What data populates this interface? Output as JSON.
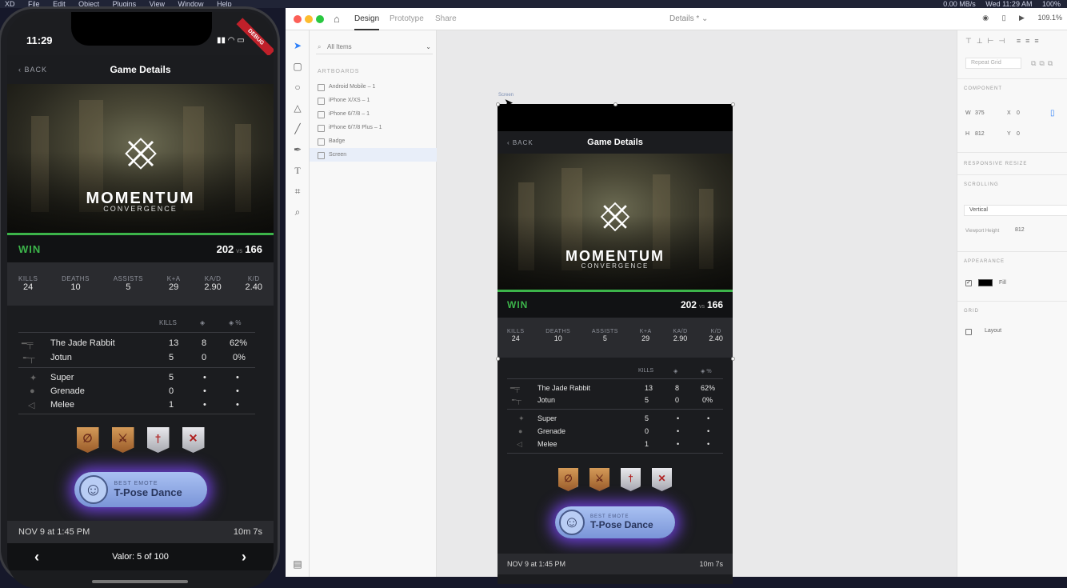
{
  "menubar": {
    "app": "XD",
    "items": [
      "File",
      "Edit",
      "Object",
      "Plugins",
      "View",
      "Window",
      "Help"
    ],
    "right": [
      "0.00 MB/s",
      "Wed 11:29 AM",
      "100%"
    ]
  },
  "phone": {
    "time": "11:29",
    "debug": "DEBUG",
    "valor_prev": "‹",
    "valor_text": "Valor: 5 of 100",
    "valor_next": "›"
  },
  "game": {
    "back": "BACK",
    "title": "Game Details",
    "map_name": "MOMENTUM",
    "map_sub": "CONVERGENCE",
    "result": "WIN",
    "score_a": "202",
    "vs": "vs",
    "score_b": "166",
    "stats": [
      {
        "label": "KILLS",
        "value": "24"
      },
      {
        "label": "DEATHS",
        "value": "10"
      },
      {
        "label": "ASSISTS",
        "value": "5"
      },
      {
        "label": "K+A",
        "value": "29"
      },
      {
        "label": "KA/D",
        "value": "2.90"
      },
      {
        "label": "K/D",
        "value": "2.40"
      }
    ],
    "table_headers": [
      "KILLS",
      "◈",
      "◈ %"
    ],
    "weapons": [
      {
        "name": "The Jade Rabbit",
        "kills": "13",
        "prec": "8",
        "pct": "62%"
      },
      {
        "name": "Jotun",
        "kills": "5",
        "prec": "0",
        "pct": "0%"
      }
    ],
    "abilities": [
      {
        "name": "Super",
        "kills": "5",
        "prec": "•",
        "pct": "•"
      },
      {
        "name": "Grenade",
        "kills": "0",
        "prec": "•",
        "pct": "•"
      },
      {
        "name": "Melee",
        "kills": "1",
        "prec": "•",
        "pct": "•"
      }
    ],
    "medal_badges": [
      "2",
      "",
      "3",
      ""
    ],
    "emote_label": "BEST EMOTE",
    "emote_name": "T-Pose Dance",
    "date": "NOV 9 at 1:45 PM",
    "duration": "10m 7s"
  },
  "xd": {
    "tabs": [
      "Design",
      "Prototype",
      "Share"
    ],
    "doc_title": "Details * ⌄",
    "zoom": "109.1%",
    "search_placeholder": "All Items",
    "artboards_header": "ARTBOARDS",
    "artboards": [
      "Android Mobile – 1",
      "iPhone X/XS – 1",
      "iPhone 6/7/8 – 1",
      "iPhone 6/7/8 Plus – 1",
      "Badge",
      "Screen"
    ],
    "selected_artboard": "Screen",
    "canvas_label": "Screen",
    "props": {
      "repeat_grid": "Repeat Grid",
      "component": "COMPONENT",
      "w_label": "W",
      "w": "375",
      "x_label": "X",
      "x": "0",
      "h_label": "H",
      "h": "812",
      "y_label": "Y",
      "y": "0",
      "responsive": "RESPONSIVE RESIZE",
      "scrolling": "SCROLLING",
      "scrolling_value": "Vertical",
      "viewport_label": "Viewport Height",
      "viewport": "812",
      "appearance": "APPEARANCE",
      "fill": "Fill",
      "grid": "GRID",
      "layout": "Layout"
    }
  }
}
